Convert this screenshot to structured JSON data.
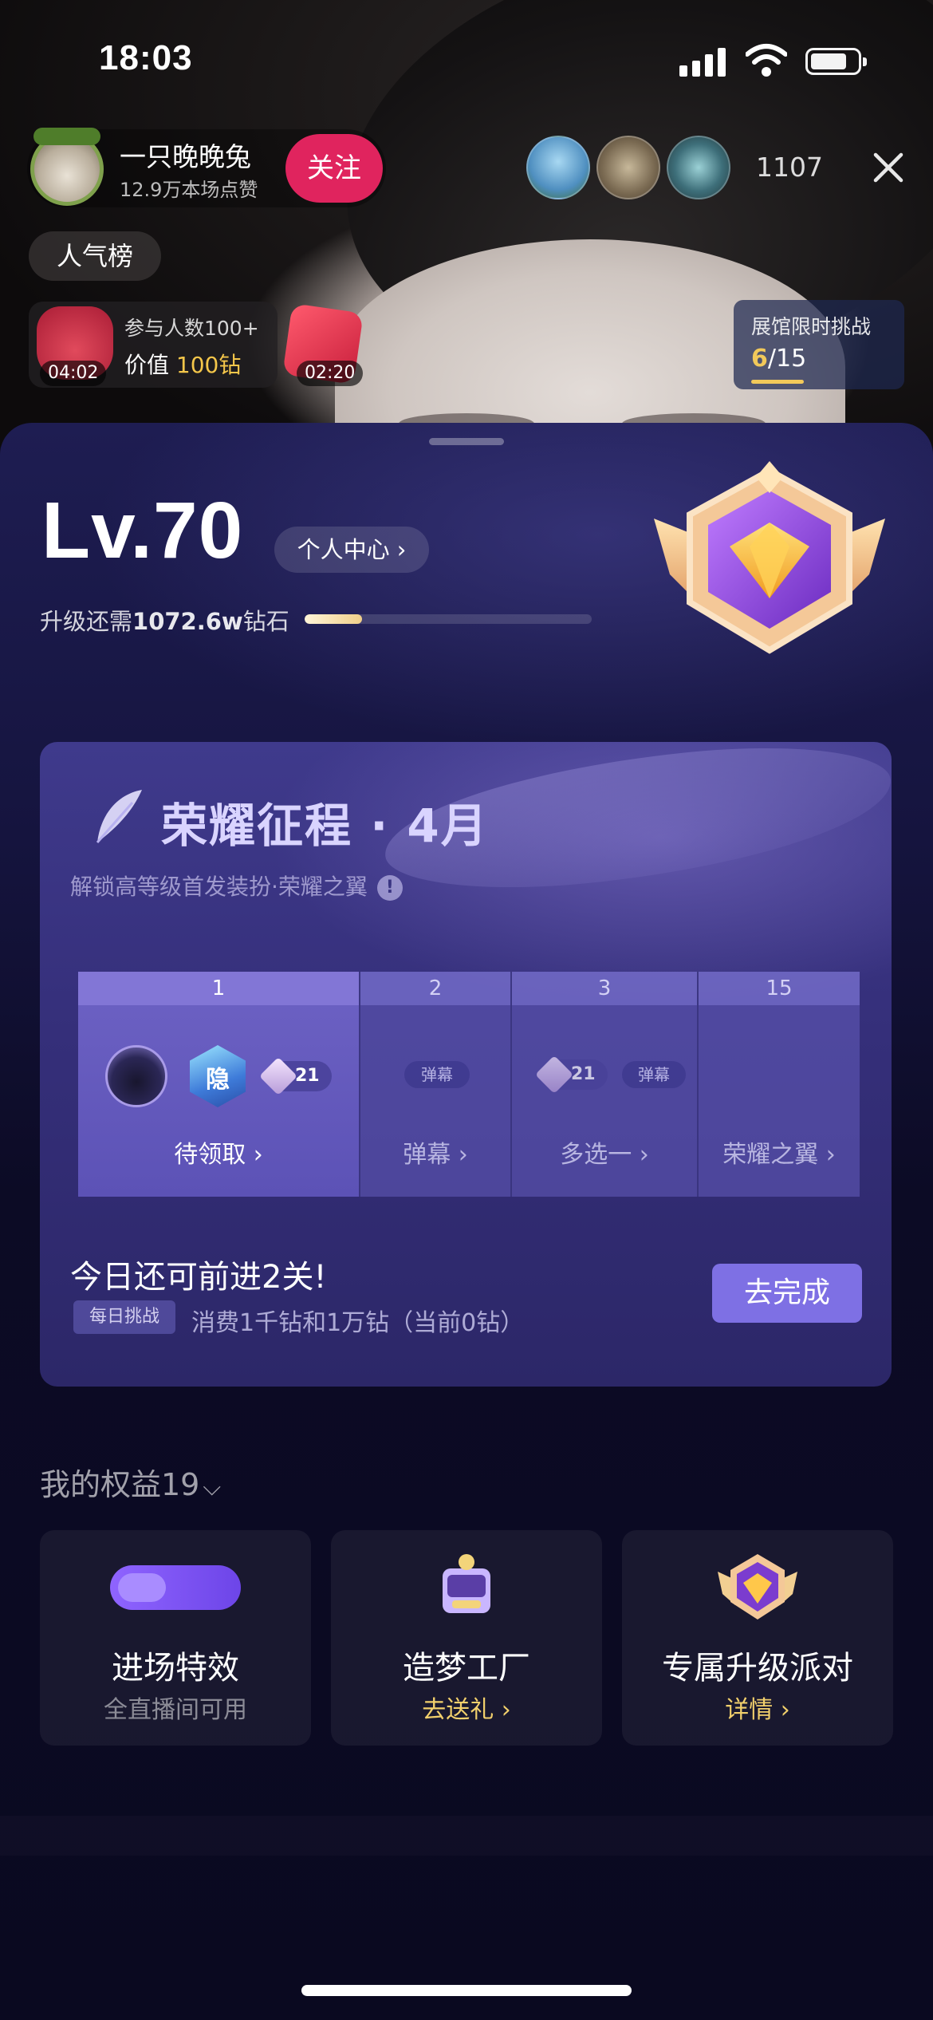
{
  "status_bar": {
    "time": "18:03"
  },
  "host": {
    "name": "一只晚晚兔",
    "likes": "12.9万本场点赞",
    "follow_label": "关注",
    "viewer_count": "1107"
  },
  "rank_label": "人气榜",
  "redbag": {
    "timer": "04:02",
    "line1": "参与人数100+",
    "value_prefix": "价值",
    "value_amount": "100钻"
  },
  "giftbox": {
    "timer": "02:20"
  },
  "challenge": {
    "title": "展馆限时挑战",
    "current": "6",
    "total": "/15",
    "progress": 0.4
  },
  "level": {
    "title": "Lv.70",
    "personal_center": "个人中心 ›",
    "upgrade_prefix": "升级还需",
    "upgrade_amount": "1072.6w",
    "upgrade_suffix": "钻石",
    "progress": 0.2
  },
  "glory": {
    "title": "荣耀征程 · 4月",
    "subtitle": "解锁高等级首发装扮·荣耀之翼",
    "stages": [
      {
        "num": "1",
        "label": "待领取 ›",
        "diamond": "21",
        "hex_text": "隐"
      },
      {
        "num": "2",
        "label": "弹幕 ›",
        "chip": "弹幕"
      },
      {
        "num": "3",
        "label": "多选一 ›",
        "diamond": "21",
        "chip": "弹幕"
      },
      {
        "num": "15",
        "label": "荣耀之翼 ›"
      }
    ],
    "today_text": "今日还可前进2关!",
    "daily_tag": "每日挑战",
    "daily_desc": "消费1千钻和1万钻（当前0钻）",
    "go_button": "去完成"
  },
  "benefits": {
    "title": "我的权益19",
    "items": [
      {
        "name": "进场特效",
        "sub": "全直播间可用"
      },
      {
        "name": "造梦工厂",
        "sub": "去送礼 ›"
      },
      {
        "name": "专属升级派对",
        "sub": "详情 ›"
      }
    ]
  },
  "colors": {
    "accent": "#7e70e4",
    "follow": "#e0245e",
    "gold": "#f2d06c"
  }
}
